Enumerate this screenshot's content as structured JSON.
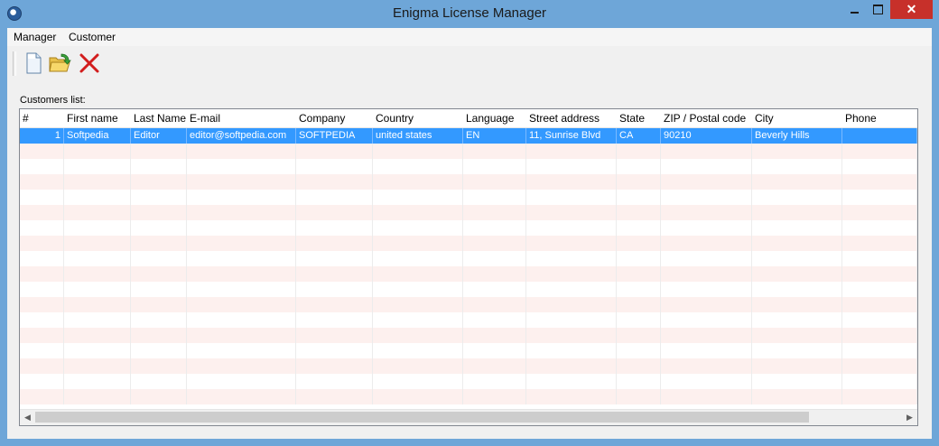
{
  "window": {
    "title": "Enigma License Manager"
  },
  "titlebar_buttons": {
    "minimize": "",
    "maximize": "",
    "close": "✕"
  },
  "menu": {
    "items": [
      {
        "label": "Manager"
      },
      {
        "label": "Customer"
      }
    ]
  },
  "toolbar": {
    "icons": [
      "new-document-icon",
      "open-folder-icon",
      "delete-icon"
    ]
  },
  "customers": {
    "label": "Customers list:",
    "columns": [
      "#",
      "First name",
      "Last Name",
      "E-mail",
      "Company",
      "Country",
      "Language",
      "Street address",
      "State",
      "ZIP / Postal code",
      "City",
      "Phone"
    ],
    "rows": [
      {
        "num": "1",
        "first_name": "Softpedia",
        "last_name": "Editor",
        "email": "editor@softpedia.com",
        "company": "SOFTPEDIA",
        "country": "united states",
        "language": "EN",
        "street": "11, Sunrise Blvd",
        "state": "CA",
        "zip": "90210",
        "city": "Beverly Hills",
        "phone": ""
      }
    ]
  },
  "colors": {
    "titlebar": "#6ea6d8",
    "close_button": "#c7302a",
    "selection": "#3399ff",
    "alt_row": "#fdf0ee"
  }
}
